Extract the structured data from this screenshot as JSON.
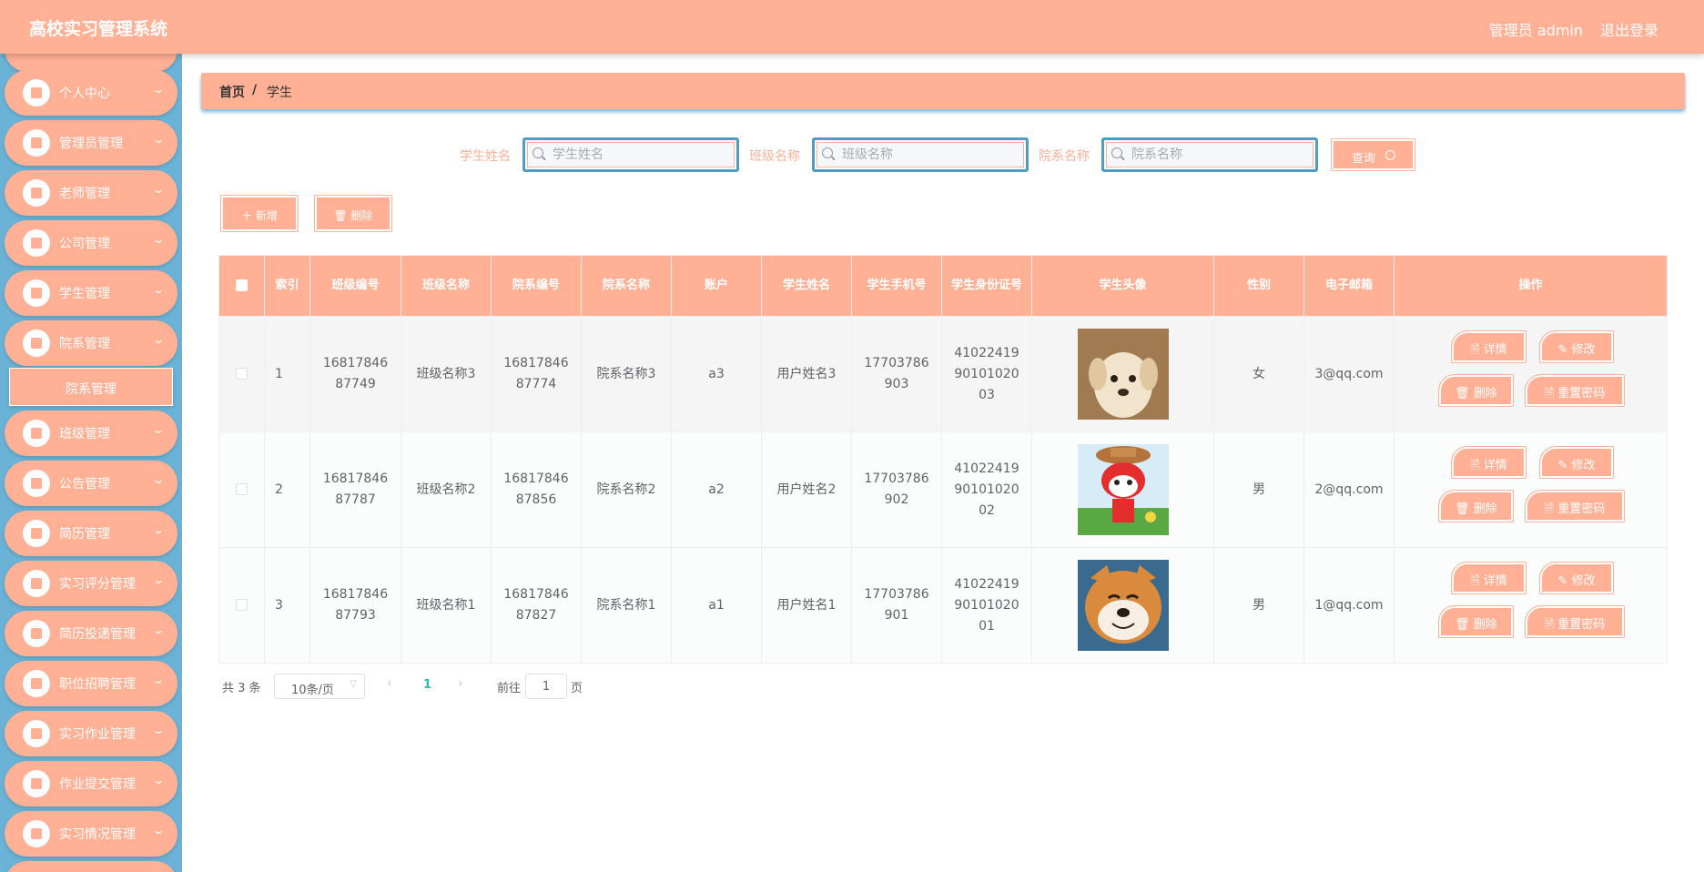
{
  "header": {
    "title": "高校实习管理系统",
    "user": "管理员 admin",
    "logout": "退出登录"
  },
  "sidebar": {
    "items": [
      {
        "label": "个人中心"
      },
      {
        "label": "管理员管理"
      },
      {
        "label": "老师管理"
      },
      {
        "label": "公司管理"
      },
      {
        "label": "学生管理"
      },
      {
        "label": "院系管理"
      },
      {
        "label": "班级管理"
      },
      {
        "label": "公告管理"
      },
      {
        "label": "简历管理"
      },
      {
        "label": "实习评分管理"
      },
      {
        "label": "简历投递管理"
      },
      {
        "label": "职位招聘管理"
      },
      {
        "label": "实习作业管理"
      },
      {
        "label": "作业提交管理"
      },
      {
        "label": "实习情况管理"
      }
    ],
    "submenu": "院系管理"
  },
  "breadcrumb": {
    "home": "首页",
    "sep": "/",
    "current": "学生"
  },
  "search": {
    "name_label": "学生姓名",
    "name_placeholder": "学生姓名",
    "class_label": "班级名称",
    "class_placeholder": "班级名称",
    "dept_label": "院系名称",
    "dept_placeholder": "院系名称",
    "query": "查询"
  },
  "actions": {
    "add": "＋ 新增",
    "delete": "🗑 删除"
  },
  "table": {
    "headers": [
      "索引",
      "班级编号",
      "班级名称",
      "院系编号",
      "院系名称",
      "账户",
      "学生姓名",
      "学生手机号",
      "学生身份证号",
      "学生头像",
      "性别",
      "电子邮箱",
      "操作"
    ],
    "rows": [
      {
        "index": "1",
        "class_no": "1681784687749",
        "class_name": "班级名称3",
        "dept_no": "1681784687774",
        "dept_name": "院系名称3",
        "account": "a3",
        "student_name": "用户姓名3",
        "phone": "17703786903",
        "id_card": "410224199010102003",
        "gender": "女",
        "email": "3@qq.com",
        "avatar": "puppy"
      },
      {
        "index": "2",
        "class_no": "1681784687787",
        "class_name": "班级名称2",
        "dept_no": "1681784687856",
        "dept_name": "院系名称2",
        "account": "a2",
        "student_name": "用户姓名2",
        "phone": "17703786902",
        "id_card": "410224199010102002",
        "gender": "男",
        "email": "2@qq.com",
        "avatar": "cartoon-fox"
      },
      {
        "index": "3",
        "class_no": "1681784687793",
        "class_name": "班级名称1",
        "dept_no": "1681784687827",
        "dept_name": "院系名称1",
        "account": "a1",
        "student_name": "用户姓名1",
        "phone": "17703786901",
        "id_card": "410224199010102001",
        "gender": "男",
        "email": "1@qq.com",
        "avatar": "shiba"
      }
    ],
    "ops": {
      "detail": "🗎 详情",
      "edit": "✎ 修改",
      "delete": "🗑 删除",
      "reset": "🗎 重置密码"
    }
  },
  "pagination": {
    "total": "共 3 条",
    "size": "10条/页",
    "current": "1",
    "goto": "前往",
    "goto_value": "1",
    "page": "页"
  }
}
